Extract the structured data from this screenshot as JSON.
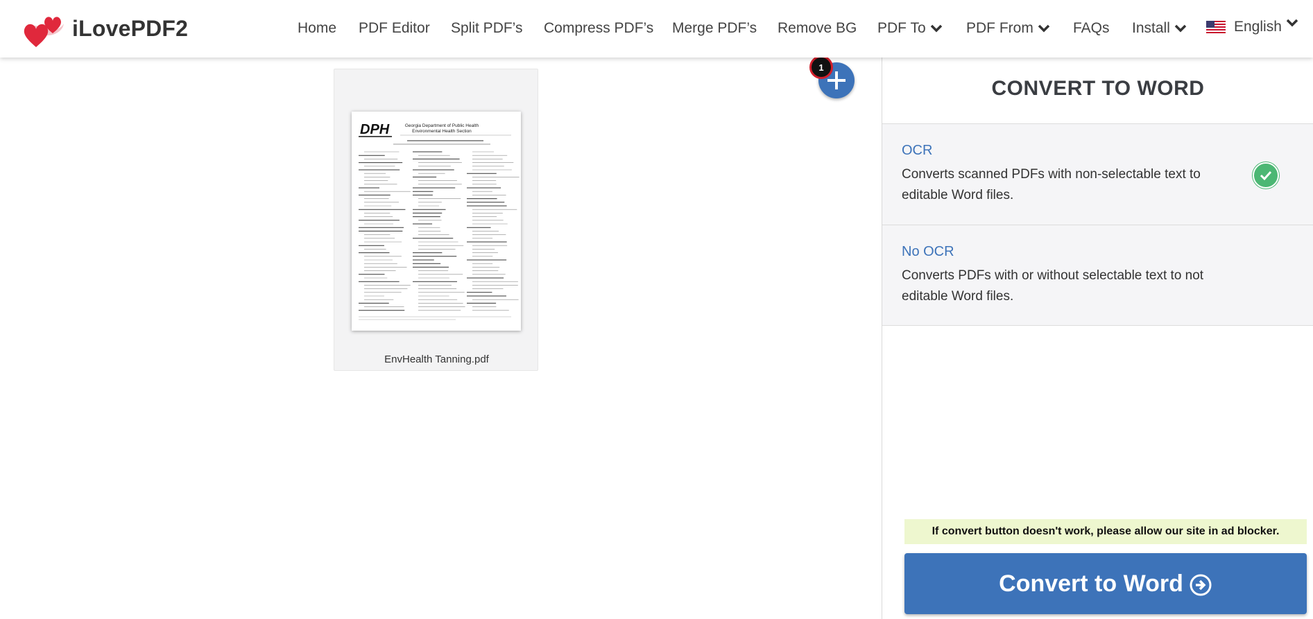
{
  "header": {
    "logo_text": "iLovePDF2",
    "nav": [
      {
        "label": "Home"
      },
      {
        "label": "PDF Editor"
      },
      {
        "label": "Split PDF’s"
      },
      {
        "label": "Compress PDF’s"
      },
      {
        "label": "Merge PDF’s"
      },
      {
        "label": "Remove BG"
      },
      {
        "label": "PDF To"
      },
      {
        "label": "PDF From"
      },
      {
        "label": "FAQs"
      },
      {
        "label": "Install"
      }
    ],
    "language": "English"
  },
  "main": {
    "file": {
      "name": "EnvHealth Tanning.pdf",
      "thumb_heading_1": "Georgia Department of Public Health",
      "thumb_heading_2": "Environmental Health Section",
      "thumb_logo": "DPH"
    },
    "file_count_badge": "1"
  },
  "sidebar": {
    "title": "CONVERT TO WORD",
    "options": [
      {
        "title": "OCR",
        "description": "Converts scanned PDFs with non-selectable text to editable Word files."
      },
      {
        "title": "No OCR",
        "description": "Converts PDFs with or without selectable text to not editable Word files."
      }
    ],
    "adblock_note": "If convert button doesn't work, please allow our site in ad blocker.",
    "convert_label": "Convert to Word"
  },
  "colors": {
    "accent": "#3d73b9",
    "check": "#4cb774",
    "badge_border": "#d21f2b",
    "note_bg": "#eef7cf"
  }
}
